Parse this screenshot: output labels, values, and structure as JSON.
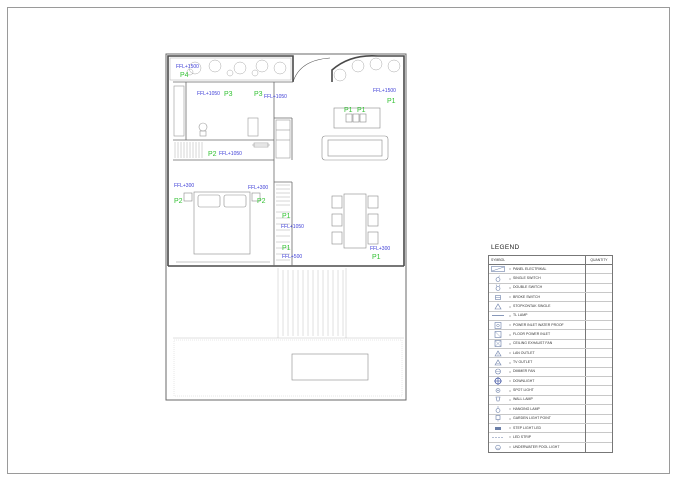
{
  "plan": {
    "level_labels": {
      "ffl_1500_a": "FFL+1500",
      "ffl_1500_b": "FFL+1500",
      "ffl_1050_a": "FFL+1050",
      "ffl_1050_b": "FFL+1050",
      "ffl_1050_c": "FFL+1050",
      "ffl_1050_d": "FFL+1050",
      "ffl_300_a": "FFL+300",
      "ffl_300_b": "FFL+300",
      "ffl_300_c": "FFL+300",
      "ffl_500": "FFL+500"
    },
    "point_labels": {
      "p4": "P4",
      "p3_a": "P3",
      "p3_b": "P3",
      "p1_a": "P1",
      "p1_b": "P1",
      "p1_c": "P1",
      "p2_a": "P2",
      "p2_b": "P2",
      "p2_c": "P2",
      "p1_d": "P1",
      "p1_e": "P1",
      "p1_f": "P1"
    },
    "colors": {
      "level_label": "#3d3dd6",
      "point_label": "#33c233",
      "wall": "#555555",
      "furniture": "#9a9a9a"
    }
  },
  "legend": {
    "title": "LEGEND",
    "col_symbol": "SYMBOL",
    "col_quantity": "QUANTITY",
    "items": [
      {
        "label": "PANEL ELECTRIKAL",
        "icon": "panel-icon"
      },
      {
        "label": "SINGLE SWITCH",
        "icon": "single-switch-icon"
      },
      {
        "label": "DOUBLE SWITCH",
        "icon": "double-switch-icon"
      },
      {
        "label": "BROKE SWITCH",
        "icon": "broke-switch-icon"
      },
      {
        "label": "STOPKONTAK SINGLE",
        "icon": "socket-single-icon"
      },
      {
        "label": "TL LAMP",
        "icon": "tl-lamp-icon"
      },
      {
        "label": "POWER INLET WATER PROOF",
        "icon": "power-inlet-waterproof-icon"
      },
      {
        "label": "FLOOR POWER INLET",
        "icon": "floor-power-inlet-icon"
      },
      {
        "label": "CEILING EXHAUST FAN",
        "icon": "exhaust-fan-icon"
      },
      {
        "label": "LAN OUTLET",
        "icon": "lan-outlet-icon"
      },
      {
        "label": "TV OUTLET",
        "icon": "tv-outlet-icon"
      },
      {
        "label": "DIMMER FAN",
        "icon": "dimmer-fan-icon"
      },
      {
        "label": "DOWNLIGHT",
        "icon": "downlight-icon"
      },
      {
        "label": "SPOT LIGHT",
        "icon": "spot-light-icon"
      },
      {
        "label": "WALL LAMP",
        "icon": "wall-lamp-icon"
      },
      {
        "label": "HANGING LAMP",
        "icon": "hanging-lamp-icon"
      },
      {
        "label": "GARDEN LIGHT POINT",
        "icon": "garden-light-icon"
      },
      {
        "label": "STEP LIGHT LED",
        "icon": "step-light-icon"
      },
      {
        "label": "LED STRIP",
        "icon": "led-strip-icon"
      },
      {
        "label": "UNDERWATER POOL LIGHT",
        "icon": "pool-light-icon"
      }
    ]
  }
}
